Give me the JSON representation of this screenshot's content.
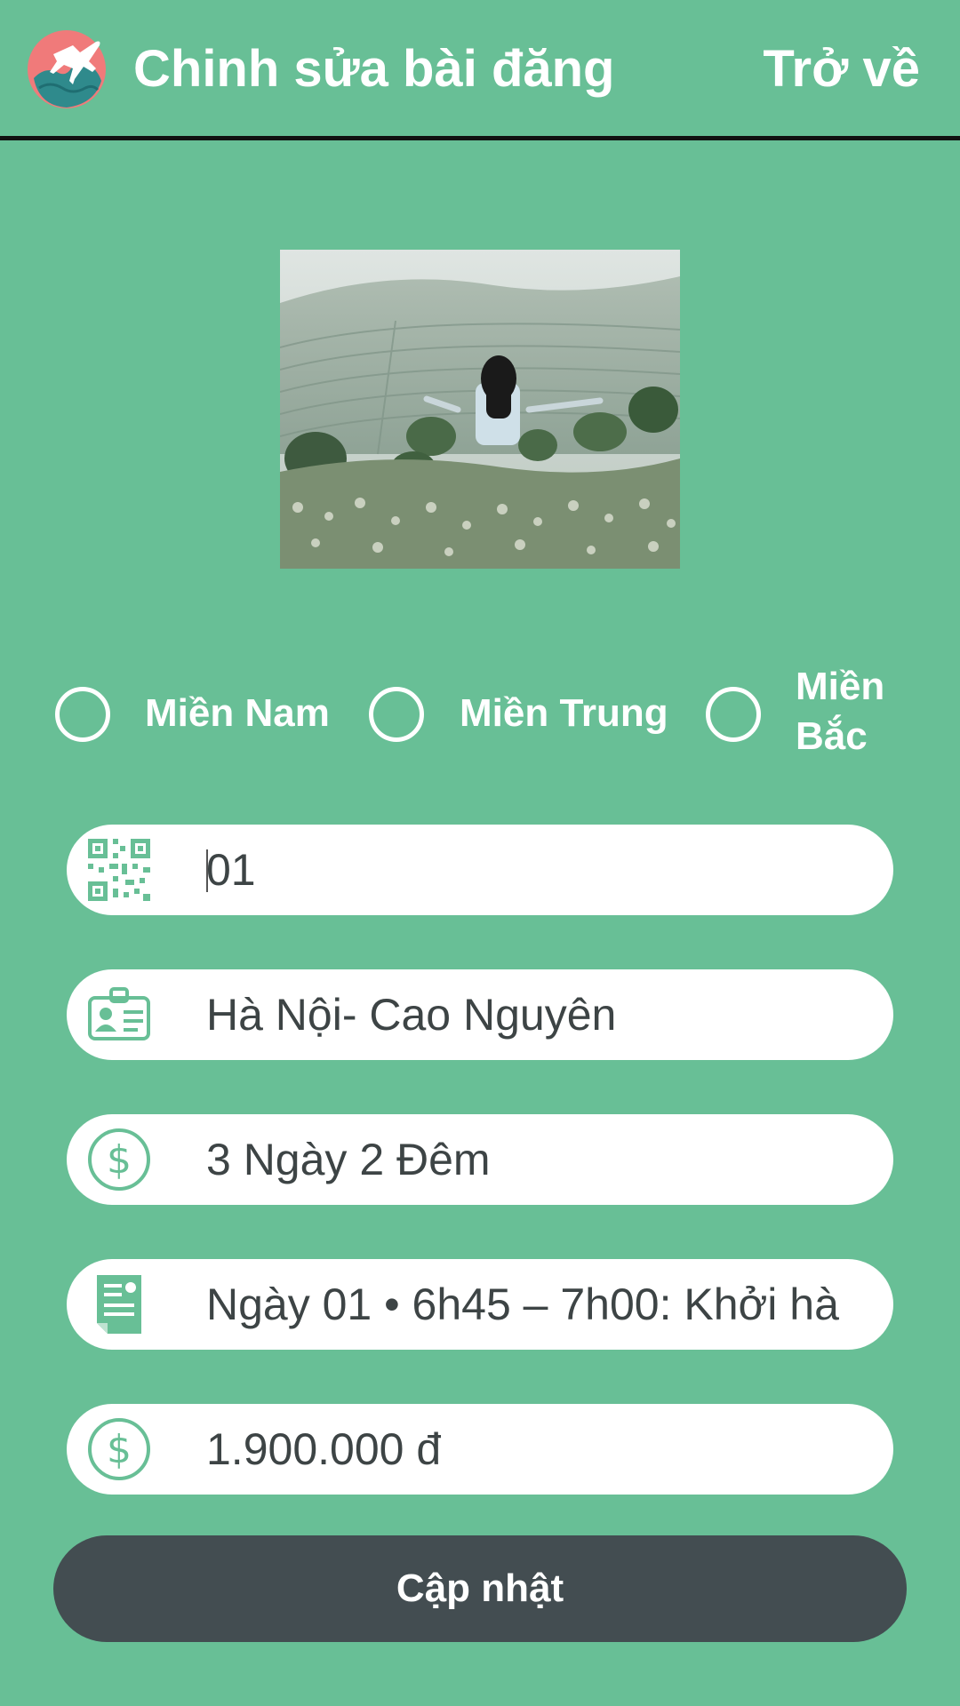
{
  "colors": {
    "background": "#68bf96",
    "field_background": "#ffffff",
    "icon_color": "#68bf96",
    "text_color": "#3d4445",
    "button_background": "#434d51"
  },
  "header": {
    "title": "Chinh sửa bài đăng",
    "back_label": "Trở về",
    "logo_icon": "globe-airplane-icon"
  },
  "regions": [
    {
      "label": "Miền Nam",
      "selected": false
    },
    {
      "label": "Miền Trung",
      "selected": false
    },
    {
      "label": "Miền\nBắc",
      "selected": false
    }
  ],
  "fields": {
    "code": {
      "value": "01",
      "icon": "qr-code-icon"
    },
    "route": {
      "value": "Hà Nội- Cao Nguyên",
      "icon": "id-card-icon"
    },
    "duration": {
      "value": "3 Ngày 2 Đêm",
      "icon": "dollar-icon"
    },
    "itinerary": {
      "value": "Ngày 01  • 6h45 – 7h00: Khởi hà",
      "icon": "document-icon"
    },
    "price": {
      "value": "1.900.000 đ",
      "icon": "dollar-icon"
    }
  },
  "update_button": {
    "label": "Cập nhật"
  }
}
